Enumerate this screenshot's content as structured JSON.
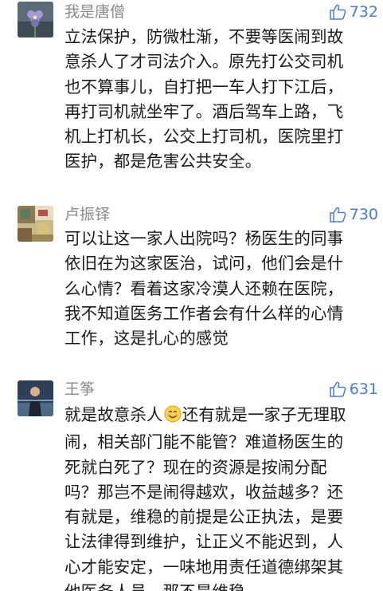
{
  "comments": [
    {
      "username": "我是唐僧",
      "likes": "732",
      "lines": [
        "立法保护，防微杜渐，不要等医闹到故",
        "意杀人了才司法介入。原先打公交司机",
        "也不算事儿，自打把一车人打下江后，",
        "再打司机就坐牢了。酒后驾车上路，飞",
        "机上打机长，公交上打司机，医院里打",
        "医护，都是危害公共安全。"
      ]
    },
    {
      "username": "卢振铎",
      "likes": "730",
      "lines": [
        "可以让这一家人出院吗？杨医生的同事",
        "依旧在为这家医治，试问，他们会是什",
        "么心情？看着这家冷漠人还赖在医院，",
        "我不知道医务工作者会有什么样的心情",
        "工作，这是扎心的感觉"
      ]
    },
    {
      "username": "王筝",
      "likes": "631",
      "line1_before": "就是故意杀人",
      "emoji": "smiling-face-emoji",
      "line1_after": "还有就是一家子无理取",
      "lines": [
        "闹，相关部门能不能管？难道杨医生的",
        "死就白死了？现在的资源是按闹分配",
        "吗？那岂不是闹得越欢，收益越多？还",
        "有就是，维稳的前提是公正执法，是要",
        "让法律得到维护，让正义不能迟到，人",
        "心才能安定，一味地用责任道德绑架其",
        "他医务人员，那不是维稳"
      ]
    }
  ],
  "colors": {
    "username": "#8a8a8a",
    "likes": "#4a7cc9",
    "body_text": "#1a1a1a"
  },
  "icons": {
    "like": "thumbs-up-icon"
  }
}
